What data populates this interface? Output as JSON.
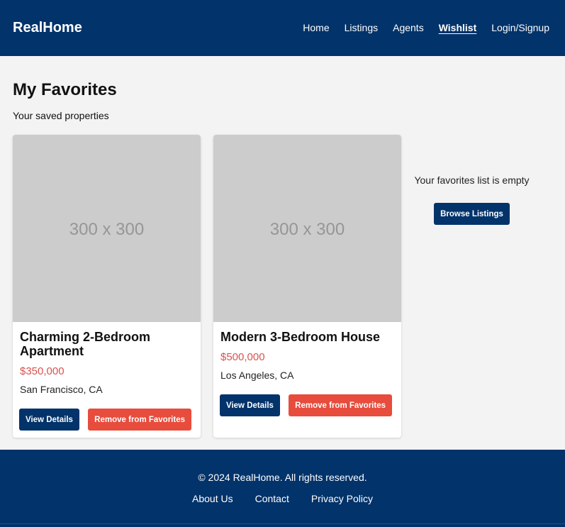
{
  "navbar": {
    "brand": "RealHome",
    "links": [
      {
        "label": "Home",
        "active": false
      },
      {
        "label": "Listings",
        "active": false
      },
      {
        "label": "Agents",
        "active": false
      },
      {
        "label": "Wishlist",
        "active": true
      },
      {
        "label": "Login/Signup",
        "active": false
      }
    ]
  },
  "main": {
    "title": "My Favorites",
    "subtitle": "Your saved properties"
  },
  "properties": [
    {
      "image_placeholder": "300 x 300",
      "title": "Charming 2-Bedroom Apartment",
      "price": "$350,000",
      "location": "San Francisco, CA",
      "view_label": "View Details",
      "remove_label": "Remove from Favorites"
    },
    {
      "image_placeholder": "300 x 300",
      "title": "Modern 3-Bedroom House",
      "price": "$500,000",
      "location": "Los Angeles, CA",
      "view_label": "View Details",
      "remove_label": "Remove from Favorites"
    }
  ],
  "empty_state": {
    "message": "Your favorites list is empty",
    "button_label": "Browse Listings"
  },
  "footer": {
    "copyright": "© 2024 RealHome. All rights reserved.",
    "links": [
      "About Us",
      "Contact",
      "Privacy Policy"
    ]
  },
  "colors": {
    "primary": "#02336a",
    "danger": "#e74c3c",
    "price": "#d9534f",
    "background": "#f3f3f3",
    "placeholder": "#cccccc"
  }
}
